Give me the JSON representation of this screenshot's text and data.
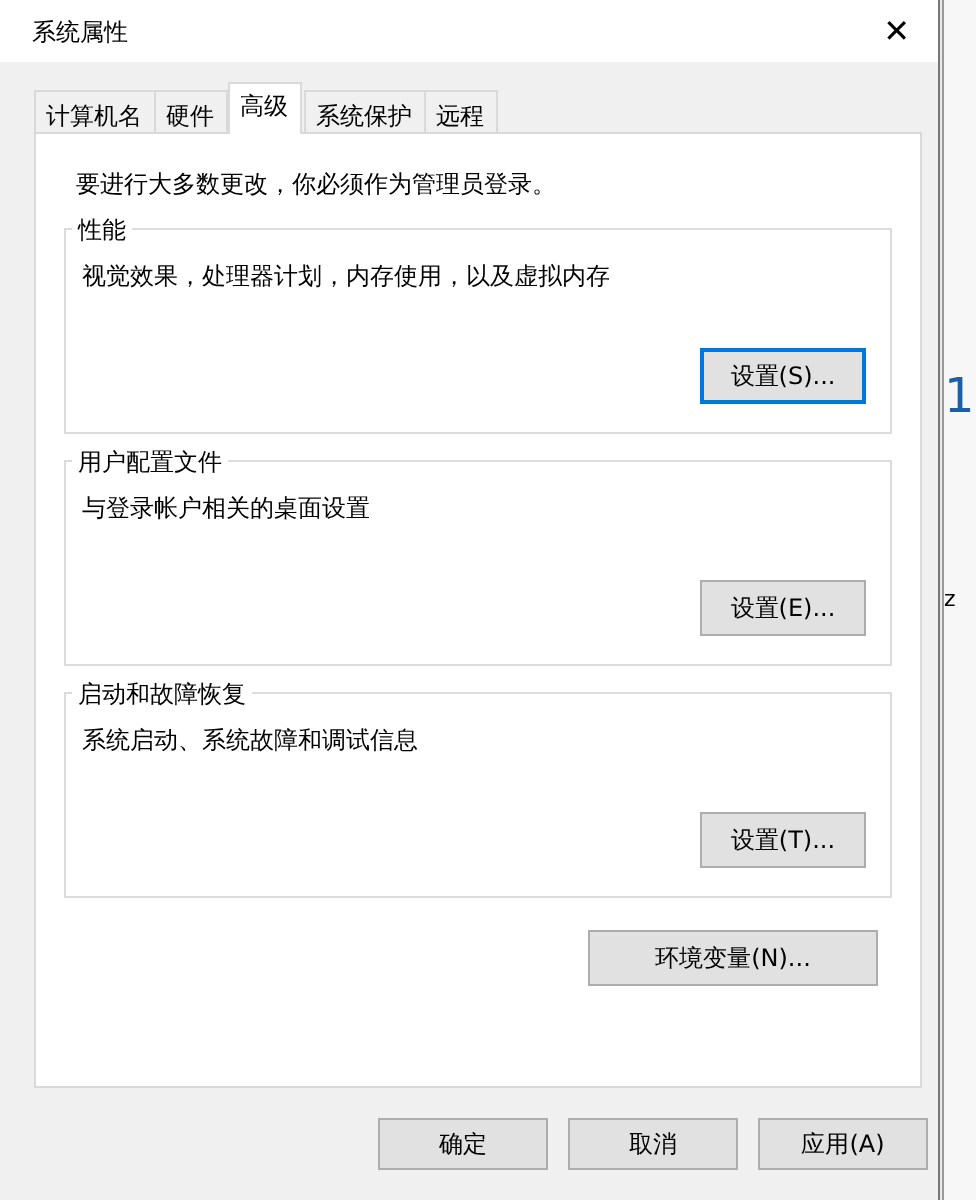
{
  "window": {
    "title": "系统属性",
    "close": "✕"
  },
  "tabs": [
    {
      "label": "计算机名",
      "selected": false
    },
    {
      "label": "硬件",
      "selected": false
    },
    {
      "label": "高级",
      "selected": true
    },
    {
      "label": "系统保护",
      "selected": false
    },
    {
      "label": "远程",
      "selected": false
    }
  ],
  "notice": "要进行大多数更改，你必须作为管理员登录。",
  "groups": [
    {
      "title": "性能",
      "description": "视觉效果，处理器计划，内存使用，以及虚拟内存",
      "button": "设置(S)...",
      "focused": true
    },
    {
      "title": "用户配置文件",
      "description": "与登录帐户相关的桌面设置",
      "button": "设置(E)...",
      "focused": false
    },
    {
      "title": "启动和故障恢复",
      "description": "系统启动、系统故障和调试信息",
      "button": "设置(T)...",
      "focused": false
    }
  ],
  "environment_button": "环境变量(N)...",
  "buttons": [
    "确定",
    "取消",
    "应用(A)"
  ],
  "background": {
    "digit": "1",
    "fragment": "z"
  }
}
